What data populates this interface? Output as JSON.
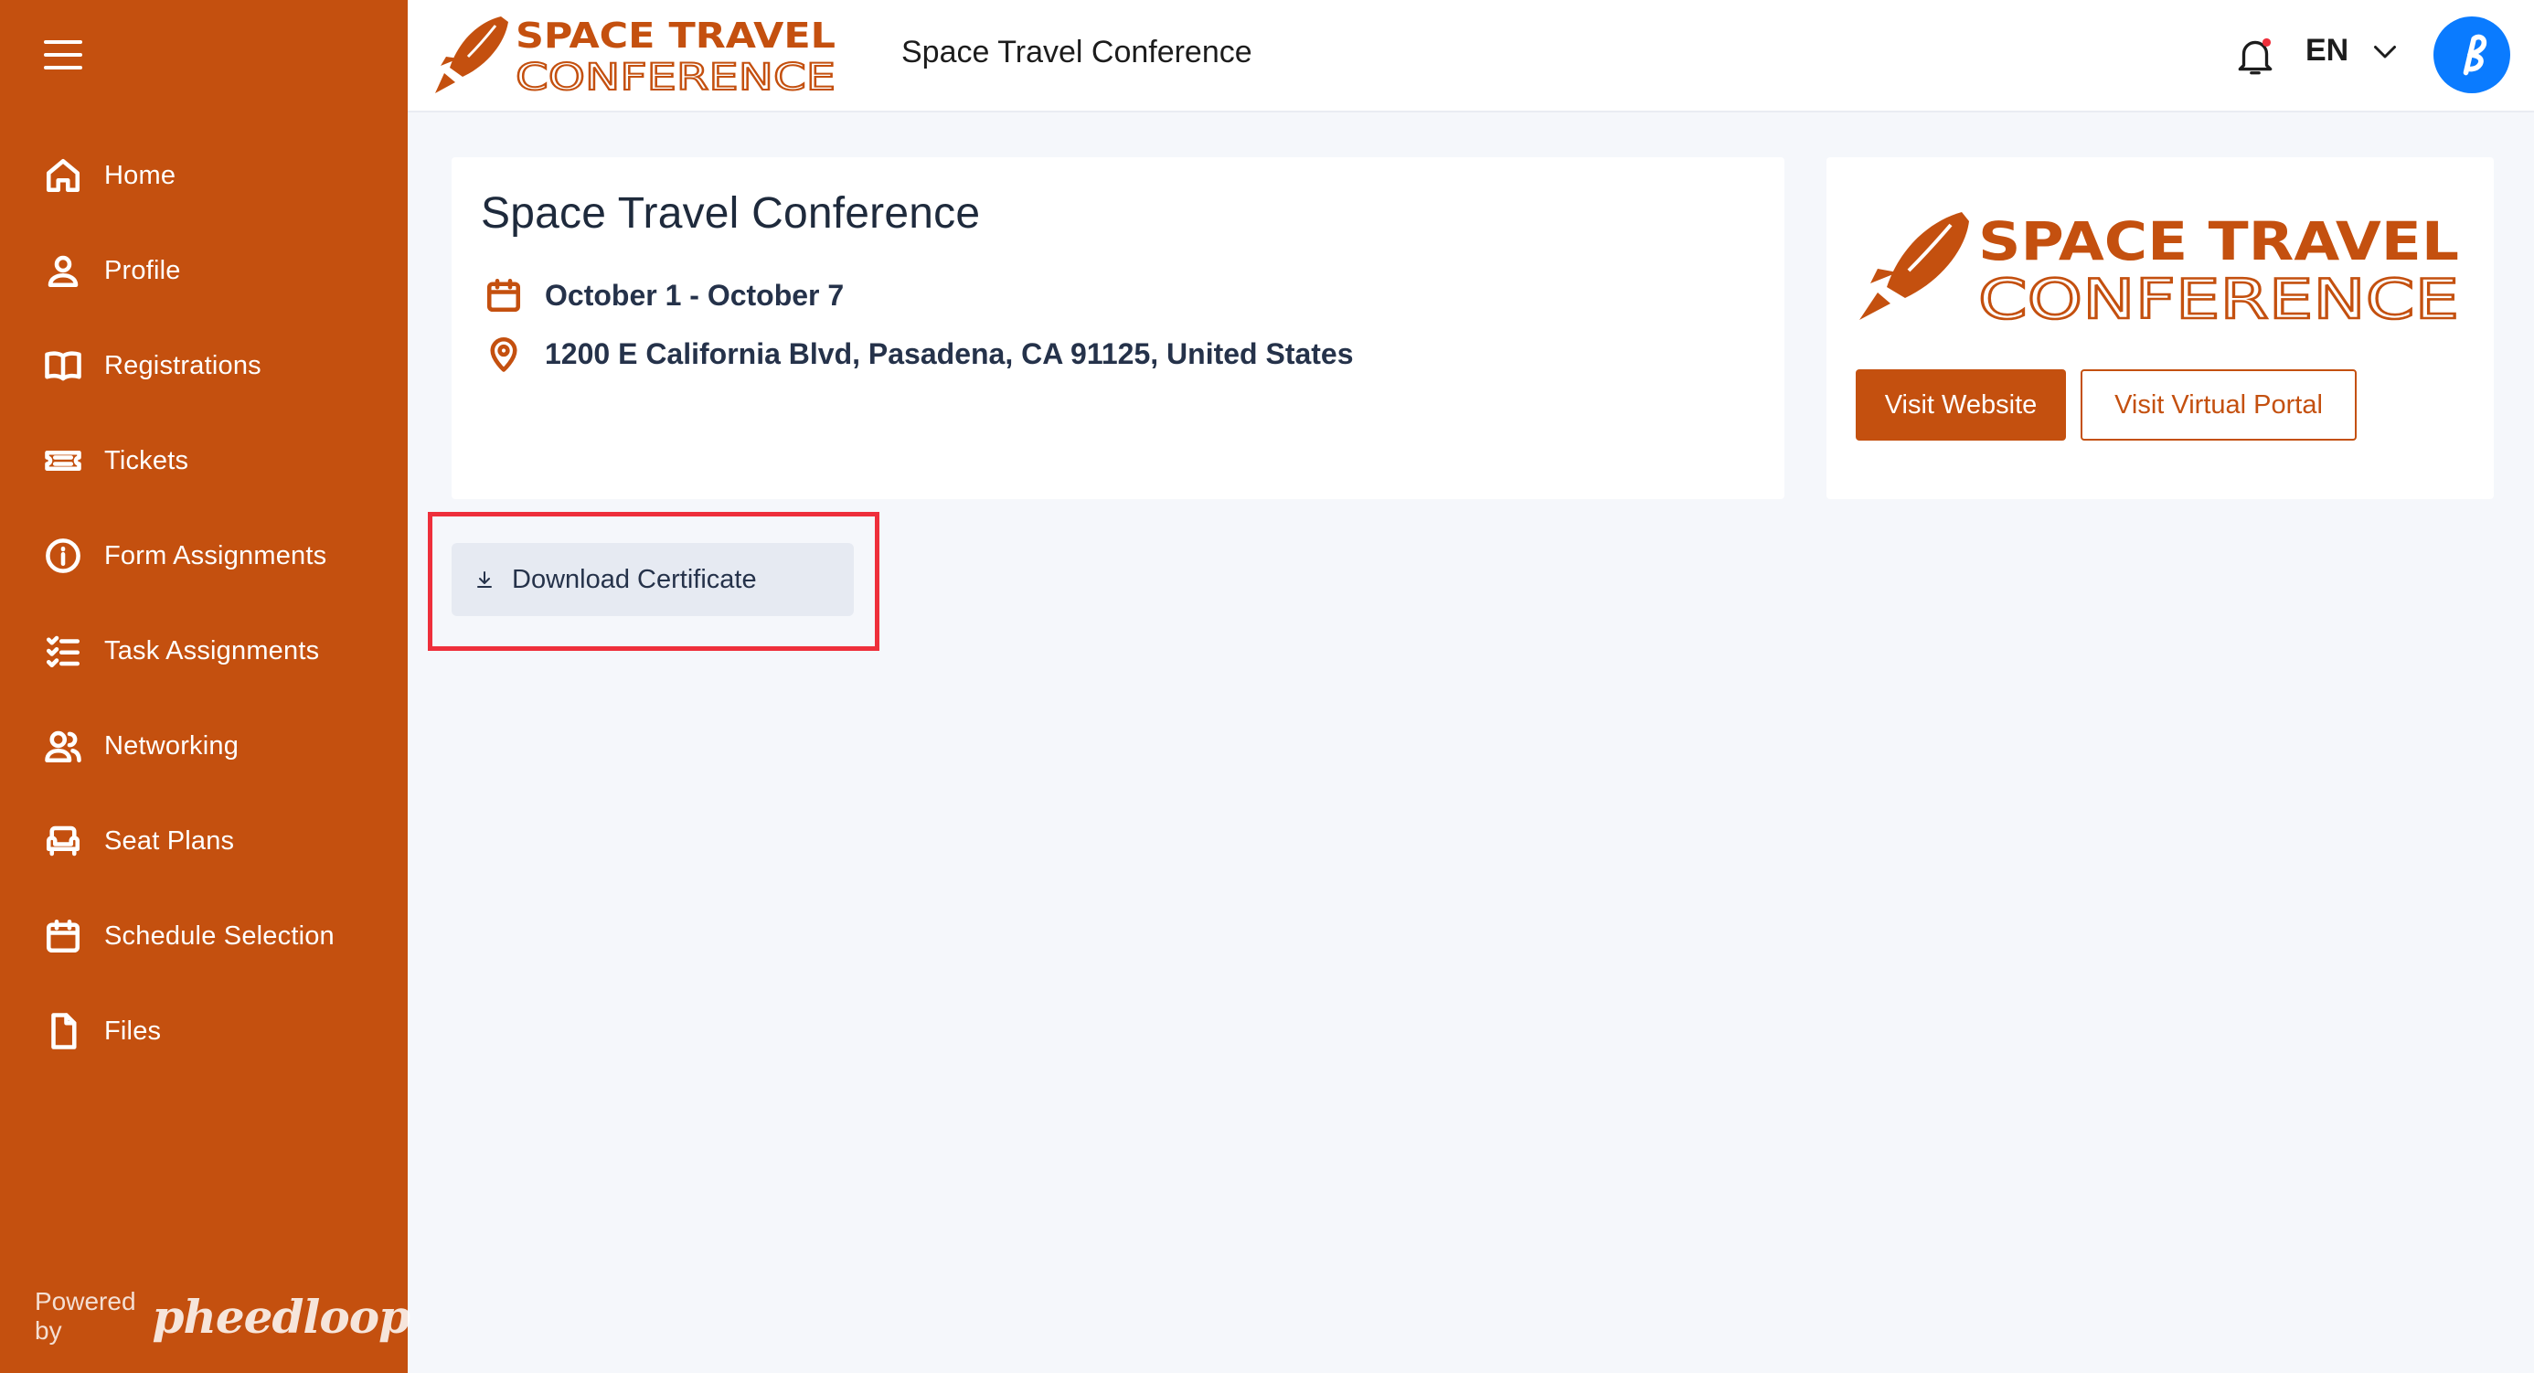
{
  "colors": {
    "brand": "#c4500f",
    "highlight": "#ee2f3b",
    "avatar": "#0a7bff"
  },
  "sidebar": {
    "items": [
      {
        "label": "Home",
        "icon": "home-icon"
      },
      {
        "label": "Profile",
        "icon": "user-icon"
      },
      {
        "label": "Registrations",
        "icon": "book-icon"
      },
      {
        "label": "Tickets",
        "icon": "ticket-icon"
      },
      {
        "label": "Form Assignments",
        "icon": "info-icon"
      },
      {
        "label": "Task Assignments",
        "icon": "checklist-icon"
      },
      {
        "label": "Networking",
        "icon": "users-icon"
      },
      {
        "label": "Seat Plans",
        "icon": "armchair-icon"
      },
      {
        "label": "Schedule Selection",
        "icon": "calendar-icon"
      },
      {
        "label": "Files",
        "icon": "file-icon"
      }
    ],
    "powered_by": "Powered by",
    "powered_brand": "pheedloop"
  },
  "header": {
    "logo_line1": "SPACE TRAVEL",
    "logo_line2": "CONFERENCE",
    "title": "Space Travel Conference",
    "language": "EN"
  },
  "event": {
    "title": "Space Travel Conference",
    "dates": "October 1 - October 7",
    "location": "1200 E California Blvd, Pasadena, CA 91125, United States"
  },
  "logo_card": {
    "logo_line1": "SPACE TRAVEL",
    "logo_line2": "CONFERENCE",
    "visit_website": "Visit Website",
    "visit_portal": "Visit Virtual Portal"
  },
  "certificate": {
    "download_label": "Download Certificate"
  }
}
